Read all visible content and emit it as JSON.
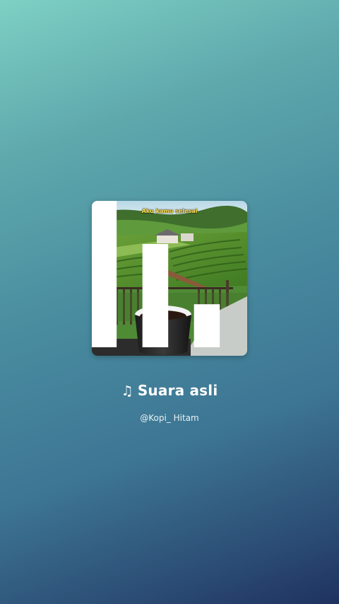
{
  "cover": {
    "caption": "Aku kamu selesai",
    "icon": "playing-bars-icon"
  },
  "track": {
    "note_icon": "music-note-icon",
    "note_glyph": "♫",
    "title": "Suara asli",
    "author": "@Kopi_ Hitam"
  }
}
